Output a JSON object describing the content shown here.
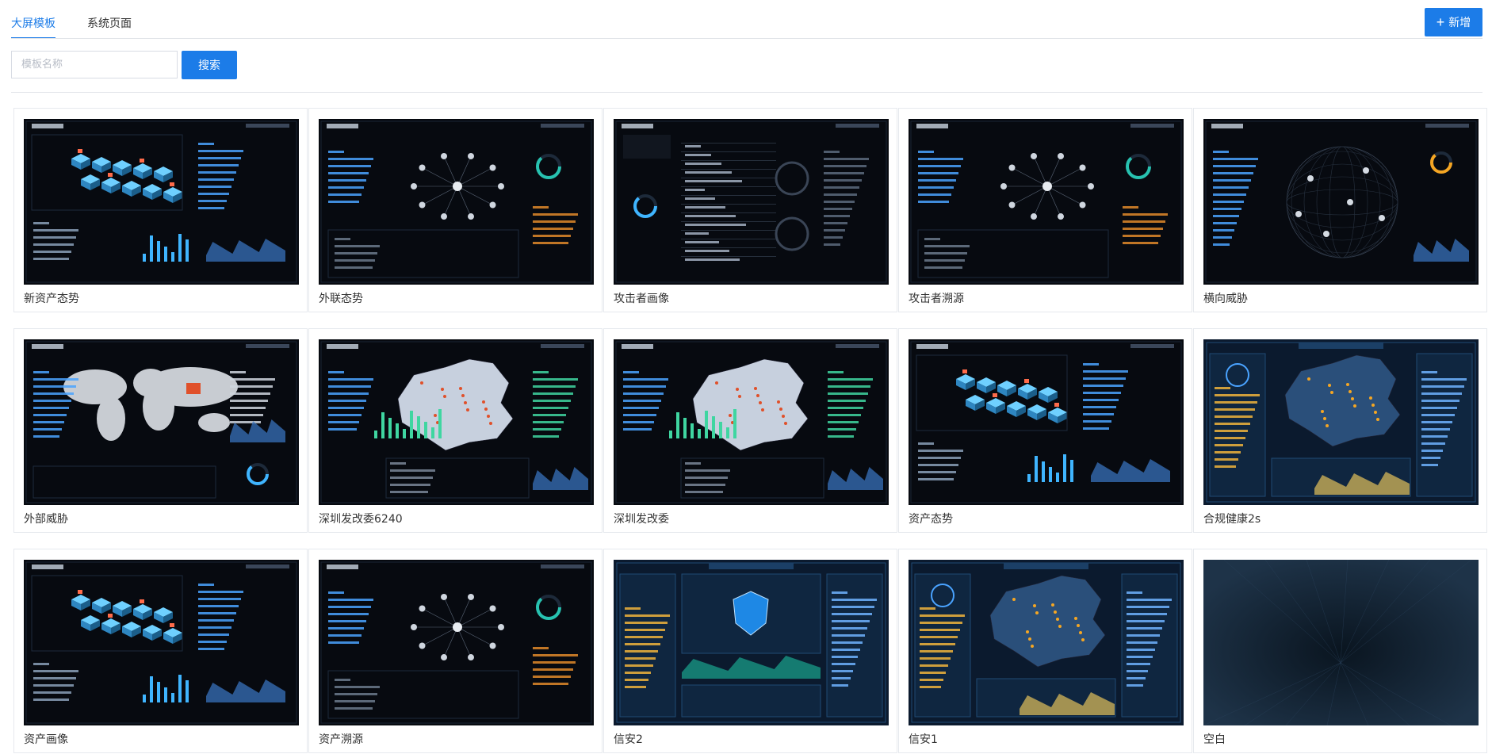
{
  "tabs": [
    "大屏模板",
    "系统页面"
  ],
  "add_button": "新增",
  "search": {
    "placeholder": "模板名称",
    "button": "搜索"
  },
  "templates": [
    {
      "name": "新资产态势",
      "style": "asset-iso"
    },
    {
      "name": "外联态势",
      "style": "network"
    },
    {
      "name": "攻击者画像",
      "style": "table-gauge"
    },
    {
      "name": "攻击者溯源",
      "style": "network"
    },
    {
      "name": "横向威胁",
      "style": "globe"
    },
    {
      "name": "外部威胁",
      "style": "worldmap"
    },
    {
      "name": "深圳发改委6240",
      "style": "chinamap"
    },
    {
      "name": "深圳发改委",
      "style": "chinamap"
    },
    {
      "name": "资产态势",
      "style": "asset-iso"
    },
    {
      "name": "合规健康2s",
      "style": "chinamap-blue"
    },
    {
      "name": "资产画像",
      "style": "asset-iso"
    },
    {
      "name": "资产溯源",
      "style": "network"
    },
    {
      "name": "信安2",
      "style": "shield"
    },
    {
      "name": "信安1",
      "style": "chinamap-blue"
    },
    {
      "name": "空白",
      "style": "blank"
    }
  ]
}
